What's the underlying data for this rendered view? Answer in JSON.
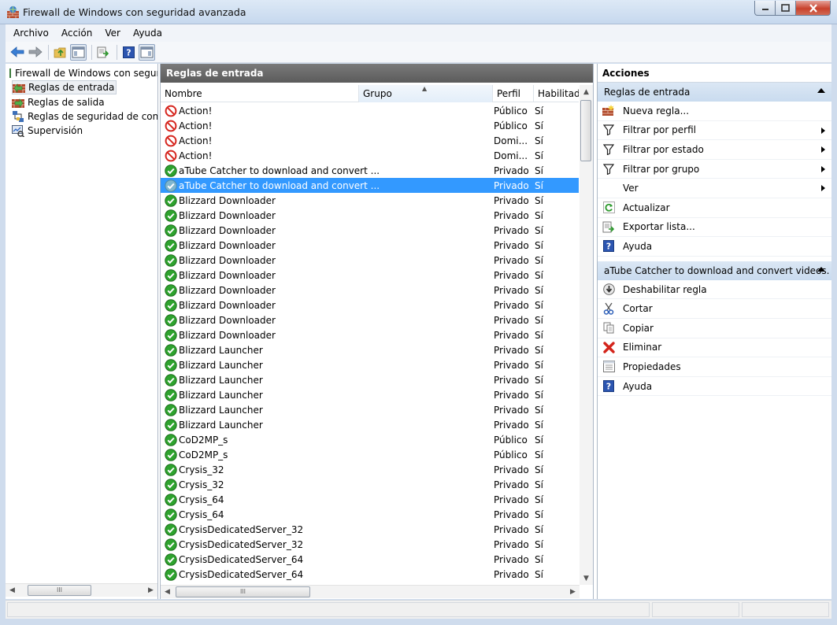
{
  "window": {
    "title": "Firewall de Windows con seguridad avanzada"
  },
  "menu": [
    "Archivo",
    "Acción",
    "Ver",
    "Ayuda"
  ],
  "tree": {
    "root": "Firewall de Windows con seguridad avanzada",
    "items": [
      {
        "label": "Reglas de entrada",
        "icon": "inbound-rules-icon",
        "selected": true
      },
      {
        "label": "Reglas de salida",
        "icon": "outbound-rules-icon"
      },
      {
        "label": "Reglas de seguridad de conexión",
        "icon": "connection-security-icon"
      },
      {
        "label": "Supervisión",
        "icon": "monitoring-icon"
      }
    ],
    "scroll_glyph": "III"
  },
  "list": {
    "header": "Reglas de entrada",
    "columns": [
      "Nombre",
      "Grupo",
      "Perfil",
      "Habilitado"
    ],
    "scroll_glyph": "III",
    "rows": [
      {
        "name": "Action!",
        "profile": "Público",
        "enabled": "Sí",
        "state": "block"
      },
      {
        "name": "Action!",
        "profile": "Público",
        "enabled": "Sí",
        "state": "block"
      },
      {
        "name": "Action!",
        "profile": "Domi...",
        "enabled": "Sí",
        "state": "block"
      },
      {
        "name": "Action!",
        "profile": "Domi...",
        "enabled": "Sí",
        "state": "block"
      },
      {
        "name": "aTube Catcher to download and convert ...",
        "profile": "Privado",
        "enabled": "Sí",
        "state": "allow"
      },
      {
        "name": "aTube Catcher to download and convert ...",
        "profile": "Privado",
        "enabled": "Sí",
        "state": "allow",
        "selected": true
      },
      {
        "name": "Blizzard Downloader",
        "profile": "Privado",
        "enabled": "Sí",
        "state": "allow"
      },
      {
        "name": "Blizzard Downloader",
        "profile": "Privado",
        "enabled": "Sí",
        "state": "allow"
      },
      {
        "name": "Blizzard Downloader",
        "profile": "Privado",
        "enabled": "Sí",
        "state": "allow"
      },
      {
        "name": "Blizzard Downloader",
        "profile": "Privado",
        "enabled": "Sí",
        "state": "allow"
      },
      {
        "name": "Blizzard Downloader",
        "profile": "Privado",
        "enabled": "Sí",
        "state": "allow"
      },
      {
        "name": "Blizzard Downloader",
        "profile": "Privado",
        "enabled": "Sí",
        "state": "allow"
      },
      {
        "name": "Blizzard Downloader",
        "profile": "Privado",
        "enabled": "Sí",
        "state": "allow"
      },
      {
        "name": "Blizzard Downloader",
        "profile": "Privado",
        "enabled": "Sí",
        "state": "allow"
      },
      {
        "name": "Blizzard Downloader",
        "profile": "Privado",
        "enabled": "Sí",
        "state": "allow"
      },
      {
        "name": "Blizzard Downloader",
        "profile": "Privado",
        "enabled": "Sí",
        "state": "allow"
      },
      {
        "name": "Blizzard Launcher",
        "profile": "Privado",
        "enabled": "Sí",
        "state": "allow"
      },
      {
        "name": "Blizzard Launcher",
        "profile": "Privado",
        "enabled": "Sí",
        "state": "allow"
      },
      {
        "name": "Blizzard Launcher",
        "profile": "Privado",
        "enabled": "Sí",
        "state": "allow"
      },
      {
        "name": "Blizzard Launcher",
        "profile": "Privado",
        "enabled": "Sí",
        "state": "allow"
      },
      {
        "name": "Blizzard Launcher",
        "profile": "Privado",
        "enabled": "Sí",
        "state": "allow"
      },
      {
        "name": "Blizzard Launcher",
        "profile": "Privado",
        "enabled": "Sí",
        "state": "allow"
      },
      {
        "name": "CoD2MP_s",
        "profile": "Público",
        "enabled": "Sí",
        "state": "allow"
      },
      {
        "name": "CoD2MP_s",
        "profile": "Público",
        "enabled": "Sí",
        "state": "allow"
      },
      {
        "name": "Crysis_32",
        "profile": "Privado",
        "enabled": "Sí",
        "state": "allow"
      },
      {
        "name": "Crysis_32",
        "profile": "Privado",
        "enabled": "Sí",
        "state": "allow"
      },
      {
        "name": "Crysis_64",
        "profile": "Privado",
        "enabled": "Sí",
        "state": "allow"
      },
      {
        "name": "Crysis_64",
        "profile": "Privado",
        "enabled": "Sí",
        "state": "allow"
      },
      {
        "name": "CrysisDedicatedServer_32",
        "profile": "Privado",
        "enabled": "Sí",
        "state": "allow"
      },
      {
        "name": "CrysisDedicatedServer_32",
        "profile": "Privado",
        "enabled": "Sí",
        "state": "allow"
      },
      {
        "name": "CrysisDedicatedServer_64",
        "profile": "Privado",
        "enabled": "Sí",
        "state": "allow"
      },
      {
        "name": "CrysisDedicatedServer_64",
        "profile": "Privado",
        "enabled": "Sí",
        "state": "allow"
      }
    ]
  },
  "actions": {
    "title": "Acciones",
    "sections": [
      {
        "header": "Reglas de entrada",
        "items": [
          {
            "label": "Nueva regla...",
            "icon": "new-rule-icon"
          },
          {
            "label": "Filtrar por perfil",
            "icon": "filter-icon",
            "submenu": true
          },
          {
            "label": "Filtrar por estado",
            "icon": "filter-icon",
            "submenu": true
          },
          {
            "label": "Filtrar por grupo",
            "icon": "filter-icon",
            "submenu": true
          },
          {
            "label": "Ver",
            "icon": "",
            "submenu": true
          },
          {
            "label": "Actualizar",
            "icon": "refresh-icon"
          },
          {
            "label": "Exportar lista...",
            "icon": "export-icon"
          },
          {
            "label": "Ayuda",
            "icon": "help-icon"
          }
        ]
      },
      {
        "header": "aTube Catcher to download and convert videos.",
        "items": [
          {
            "label": "Deshabilitar regla",
            "icon": "disable-icon"
          },
          {
            "label": "Cortar",
            "icon": "cut-icon"
          },
          {
            "label": "Copiar",
            "icon": "copy-icon"
          },
          {
            "label": "Eliminar",
            "icon": "delete-icon"
          },
          {
            "label": "Propiedades",
            "icon": "properties-icon"
          },
          {
            "label": "Ayuda",
            "icon": "help-icon"
          }
        ]
      }
    ]
  },
  "colors": {
    "selection": "#3399ff",
    "pane_header": "#6a6a6a",
    "allow": "#2ea32e",
    "block": "#d6261f"
  }
}
